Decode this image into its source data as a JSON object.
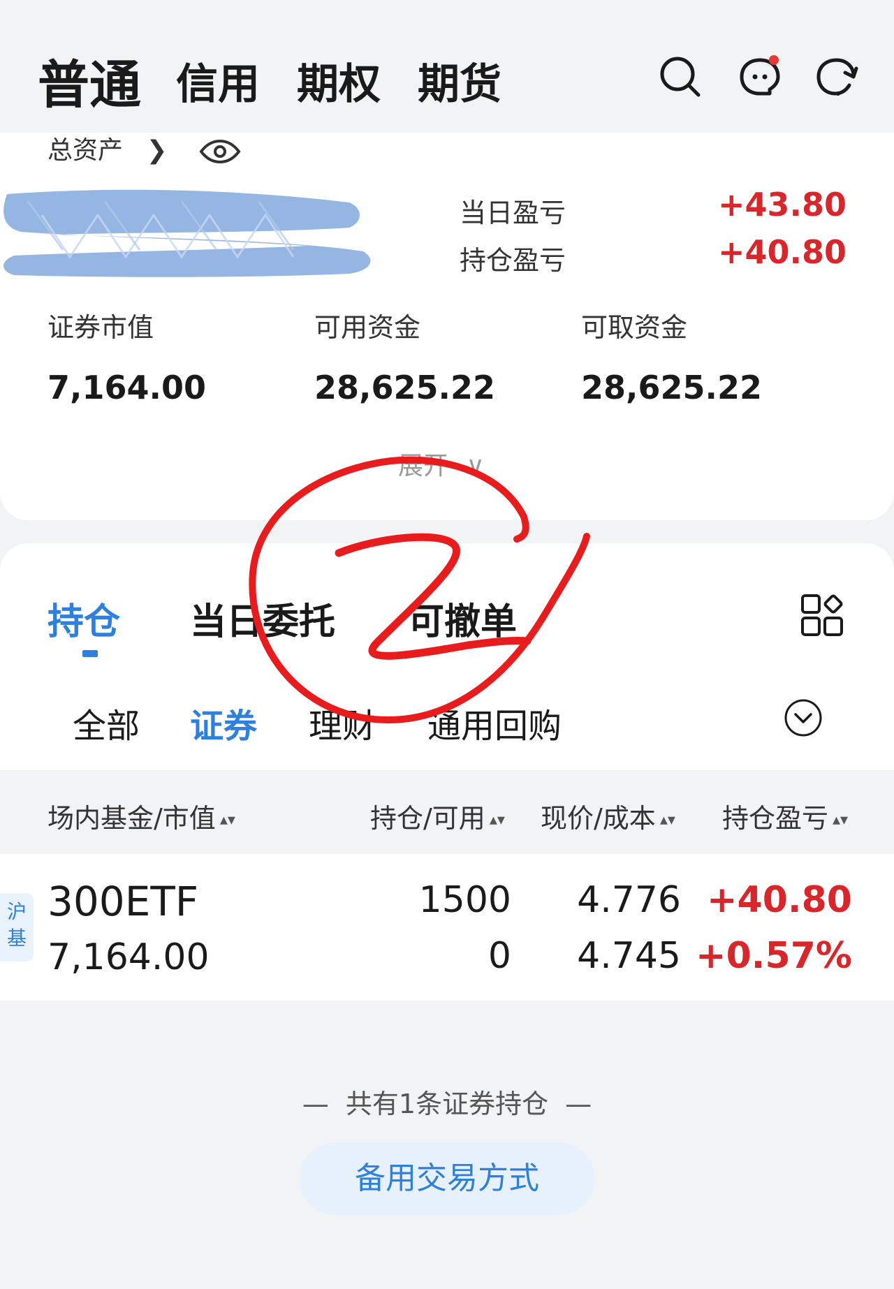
{
  "account_tabs": [
    {
      "label": "普通",
      "active": true
    },
    {
      "label": "信用",
      "active": false
    },
    {
      "label": "期权",
      "active": false
    },
    {
      "label": "期货",
      "active": false
    }
  ],
  "header_icons": [
    "search-icon",
    "chat-icon",
    "refresh-icon"
  ],
  "assets": {
    "total_label": "总资产",
    "daily_pnl_label": "当日盈亏",
    "daily_pnl_value": "+43.80",
    "position_pnl_label": "持仓盈亏",
    "position_pnl_value": "+40.80",
    "stats": [
      {
        "label": "证券市值",
        "value": "7,164.00"
      },
      {
        "label": "可用资金",
        "value": "28,625.22"
      },
      {
        "label": "可取资金",
        "value": "28,625.22"
      }
    ],
    "expand_label": "展开"
  },
  "position_tabs": [
    {
      "label": "持仓",
      "active": true
    },
    {
      "label": "当日委托",
      "active": false
    },
    {
      "label": "可撤单",
      "active": false
    }
  ],
  "sub_tabs": [
    {
      "label": "全部",
      "active": false
    },
    {
      "label": "证券",
      "active": true
    },
    {
      "label": "理财",
      "active": false
    },
    {
      "label": "通用回购",
      "active": false
    }
  ],
  "table": {
    "headers": [
      "场内基金/市值",
      "持仓/可用",
      "现价/成本",
      "持仓盈亏"
    ],
    "rows": [
      {
        "badge": "沪基",
        "name": "300ETF",
        "market_value": "7,164.00",
        "position": "1500",
        "available": "0",
        "price": "4.776",
        "cost": "4.745",
        "pnl": "+40.80",
        "pnl_pct": "+0.57%"
      }
    ]
  },
  "footer": {
    "summary": "共有1条证券持仓",
    "alt_trade_button": "备用交易方式"
  },
  "colors": {
    "accent": "#2f7fdd",
    "profit": "#d8262b",
    "background": "#f2f3f5"
  }
}
